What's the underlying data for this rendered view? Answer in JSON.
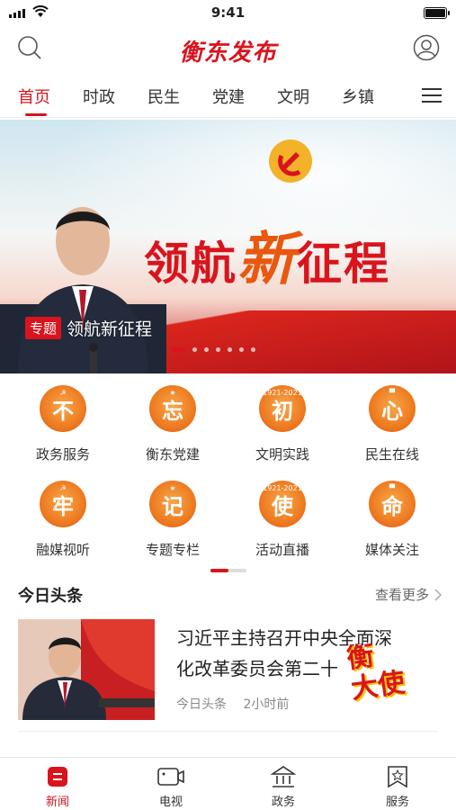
{
  "status": {
    "time": "9:41"
  },
  "header": {
    "logo": "衡东发布"
  },
  "tabs": [
    "首页",
    "时政",
    "民生",
    "党建",
    "文明",
    "乡镇"
  ],
  "banner": {
    "headline_pre": "领航",
    "headline_big": "新",
    "headline_post": "征程",
    "badge": "专题",
    "caption": "领航新征程"
  },
  "grid": [
    {
      "char": "不",
      "label": "政务服务",
      "mark": "☭"
    },
    {
      "char": "忘",
      "label": "衡东党建",
      "mark": "★"
    },
    {
      "char": "初",
      "label": "文明实践",
      "mark": "1921-2021"
    },
    {
      "char": "心",
      "label": "民生在线",
      "mark": "▀"
    },
    {
      "char": "牢",
      "label": "融媒视听",
      "mark": "☭"
    },
    {
      "char": "记",
      "label": "专题专栏",
      "mark": "★"
    },
    {
      "char": "使",
      "label": "活动直播",
      "mark": "1921-2021"
    },
    {
      "char": "命",
      "label": "媒体关注",
      "mark": "▀"
    }
  ],
  "section": {
    "title": "今日头条",
    "more": "查看更多"
  },
  "news": {
    "title": "习近平主持召开中央全面深化改革委员会第二十",
    "source": "今日头条",
    "time": "2小时前",
    "stamp_line1": "衡",
    "stamp_line2": "大使"
  },
  "tabbar": [
    {
      "label": "新闻",
      "icon": "news-icon"
    },
    {
      "label": "电视",
      "icon": "tv-icon"
    },
    {
      "label": "政务",
      "icon": "government-icon"
    },
    {
      "label": "服务",
      "icon": "service-icon"
    }
  ],
  "colors": {
    "brand": "#d9141d",
    "accent": "#ee7b20"
  }
}
